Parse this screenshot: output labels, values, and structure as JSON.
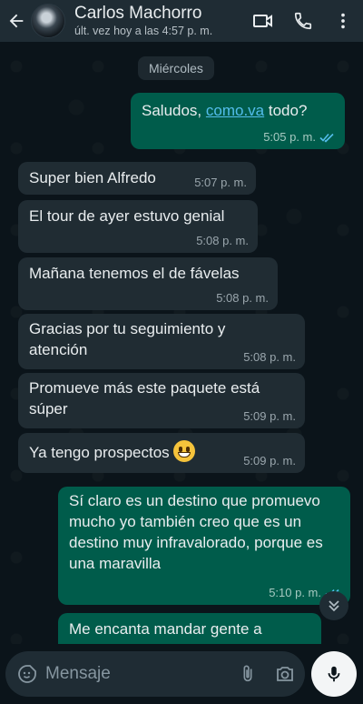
{
  "header": {
    "contact_name": "Carlos Machorro",
    "status": "últ. vez hoy a las 4:57 p. m.",
    "icons": [
      "back-arrow-icon",
      "video-call-icon",
      "phone-icon",
      "more-options-icon"
    ]
  },
  "chat": {
    "day_label": "Miércoles",
    "messages": [
      {
        "dir": "out",
        "pre": "Saludos, ",
        "link": "como.va",
        "post": " todo?",
        "time": "5:05 p. m.",
        "read": true
      },
      {
        "dir": "in",
        "text": "Super bien Alfredo",
        "time": "5:07 p. m."
      },
      {
        "dir": "in",
        "text": "El tour de ayer estuvo genial",
        "time": "5:08 p. m."
      },
      {
        "dir": "in",
        "text": "Mañana tenemos el de fávelas",
        "time": "5:08 p. m."
      },
      {
        "dir": "in",
        "text": "Gracias por tu seguimiento y atención",
        "time": "5:08 p. m."
      },
      {
        "dir": "in",
        "text": "Promueve más este paquete está súper",
        "time": "5:09 p. m."
      },
      {
        "dir": "in",
        "text": "Ya tengo prospectos",
        "emoji": "grinning-face-emoji",
        "time": "5:09 p. m."
      },
      {
        "dir": "out",
        "text": "Sí claro es un destino que promuevo mucho  yo también creo que es un destino muy infravalorado, porque es una maravilla",
        "time": "5:10 p. m.",
        "read": true
      },
      {
        "dir": "out",
        "text": "Me encanta mandar gente a",
        "time": "",
        "partial": true
      }
    ]
  },
  "composer": {
    "placeholder": "Mensaje"
  },
  "colors": {
    "background": "#0b141a",
    "header": "#1f2c34",
    "incoming_bubble": "#202c33",
    "outgoing_bubble": "#005c4b",
    "read_ticks": "#53bdeb"
  }
}
